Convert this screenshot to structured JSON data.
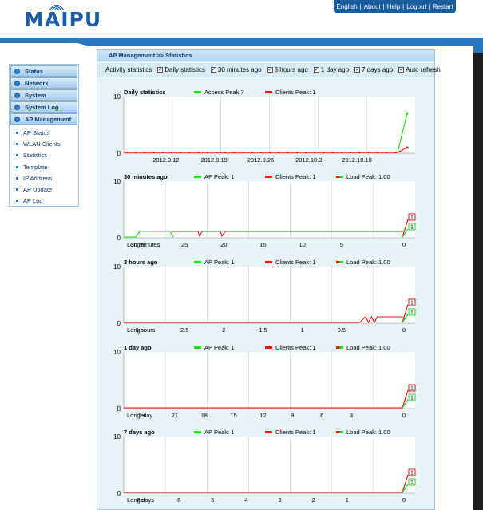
{
  "brand": {
    "logo_text": "MAIPU"
  },
  "topnav": {
    "items": [
      "English",
      "About",
      "Help",
      "Logout",
      "Restart"
    ]
  },
  "sidebar": {
    "menus": [
      {
        "label": "Status",
        "name": "status"
      },
      {
        "label": "Network",
        "name": "network"
      },
      {
        "label": "System",
        "name": "system"
      },
      {
        "label": "System Log",
        "name": "system-log"
      },
      {
        "label": "AP Management",
        "name": "ap-management"
      }
    ],
    "subitems": [
      "AP Status",
      "WLAN Clients",
      "Statistics",
      "Template",
      "IP Address",
      "AP Update",
      "AP Log"
    ]
  },
  "panel": {
    "breadcrumb": "AP Management >> Statistics",
    "options_label": "Activity statistics",
    "options": [
      {
        "label": "Daily statistics",
        "checked": true
      },
      {
        "label": "30 minutes ago",
        "checked": true
      },
      {
        "label": "3 hours ago",
        "checked": true
      },
      {
        "label": "1 day ago",
        "checked": true
      },
      {
        "label": "7 days ago",
        "checked": true
      },
      {
        "label": "Auto refresh",
        "checked": true
      }
    ]
  },
  "colors": {
    "ap": "#22dd22",
    "clients": "#ee1111",
    "grid": "#d0d0d0"
  },
  "charts": [
    {
      "title": "Daily statistics",
      "legend": [
        {
          "label": "Access Peak 7",
          "color": "#22dd22"
        },
        {
          "label": "Clients Peak: 1",
          "color": "#ee1111"
        }
      ],
      "ytop": "10",
      "ybottom": "0",
      "xlabels": [
        "2012.9.12",
        "2012.9.19",
        "2012.9.26",
        "2012.10.3",
        "2012.10.10"
      ],
      "badges": []
    },
    {
      "title": "30 minutes ago",
      "legend": [
        {
          "label": "AP Peak: 1",
          "color": "#22dd22"
        },
        {
          "label": "Clients Peak: 1",
          "color": "#ee1111"
        },
        {
          "label": "Load Peak: 1.00",
          "color": "split"
        }
      ],
      "ytop": "10",
      "ybottom": "0",
      "xlabels": [
        "Longer",
        "30 minutes",
        "25",
        "20",
        "15",
        "10",
        "5",
        "0"
      ],
      "badges": [
        "1",
        "1"
      ]
    },
    {
      "title": "3 hours ago",
      "legend": [
        {
          "label": "AP Peak: 1",
          "color": "#22dd22"
        },
        {
          "label": "Clients Peak: 1",
          "color": "#ee1111"
        },
        {
          "label": "Load Peak: 1.00",
          "color": "split"
        }
      ],
      "ytop": "10",
      "ybottom": "0",
      "xlabels": [
        "Longer",
        "3 hours",
        "2.5",
        "2",
        "1.5",
        "1",
        "0.5",
        "0"
      ],
      "badges": [
        "1",
        "1"
      ]
    },
    {
      "title": "1 day ago",
      "legend": [
        {
          "label": "AP Peak: 1",
          "color": "#22dd22"
        },
        {
          "label": "Clients Peak: 1",
          "color": "#ee1111"
        },
        {
          "label": "Load Peak: 1.00",
          "color": "split"
        }
      ],
      "ytop": "10",
      "ybottom": "0",
      "xlabels": [
        "Longer",
        "1 day",
        "21",
        "18",
        "15",
        "12",
        "9",
        "6",
        "3",
        "0"
      ],
      "badges": [
        "1",
        "1"
      ]
    },
    {
      "title": "7 days ago",
      "legend": [
        {
          "label": "AP Peak: 1",
          "color": "#22dd22"
        },
        {
          "label": "Clients Peak: 1",
          "color": "#ee1111"
        },
        {
          "label": "Load Peak: 1.00",
          "color": "split"
        }
      ],
      "ytop": "10",
      "ybottom": "0",
      "xlabels": [
        "Longer",
        "7 days",
        "6",
        "5",
        "4",
        "3",
        "2",
        "1",
        "0"
      ],
      "badges": [
        "1",
        "1"
      ]
    }
  ]
}
